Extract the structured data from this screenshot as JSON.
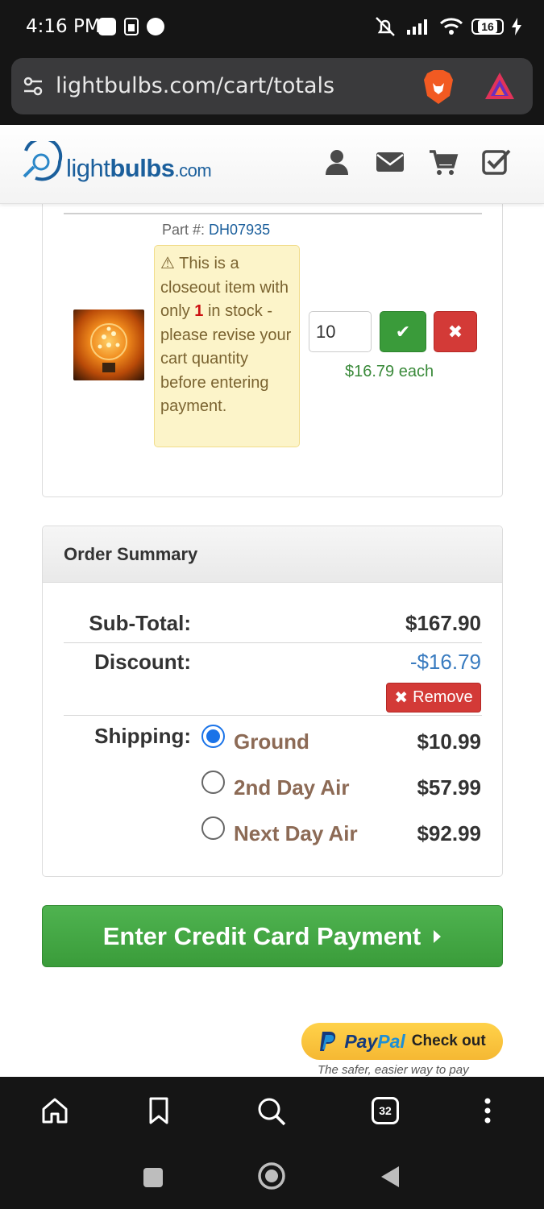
{
  "status_bar": {
    "time": "4:16 PM",
    "battery": "16"
  },
  "browser": {
    "url": "lightbulbs.com/cart/totals",
    "tab_count": "32"
  },
  "site": {
    "logo_light": "light",
    "logo_bulbs": "bulbs",
    "logo_com": ".com",
    "header_icons": [
      "user-icon",
      "envelope-icon",
      "cart-icon",
      "checklist-icon"
    ]
  },
  "cart_item": {
    "part_label": "Part #:",
    "part_number": "DH07935",
    "warning_before": "This is a closeout item with only",
    "warning_count": "1",
    "warning_after": "in stock - please revise your cart quantity before entering payment.",
    "quantity": "10",
    "each_price": "$16.79 each"
  },
  "order_summary": {
    "title": "Order Summary",
    "subtotal_label": "Sub-Total:",
    "subtotal_value": "$167.90",
    "discount_label": "Discount:",
    "discount_value": "-$16.79",
    "remove_label": "Remove",
    "shipping_label": "Shipping:",
    "shipping_options": [
      {
        "name": "Ground",
        "price": "$10.99",
        "selected": true
      },
      {
        "name": "2nd Day Air",
        "price": "$57.99",
        "selected": false
      },
      {
        "name": "Next Day Air",
        "price": "$92.99",
        "selected": false
      }
    ]
  },
  "payment": {
    "credit_card_label": "Enter Credit Card Payment",
    "paypal_pay": "Pay",
    "paypal_pal": "Pal",
    "paypal_checkout": "Check out",
    "paypal_tagline": "The safer, easier way to pay"
  },
  "colors": {
    "brand_blue": "#1b5f9c",
    "success_green": "#3a9b3a",
    "danger_red": "#d33a37",
    "warning_bg": "#fcf4c9",
    "radio_blue": "#1a73e8"
  }
}
